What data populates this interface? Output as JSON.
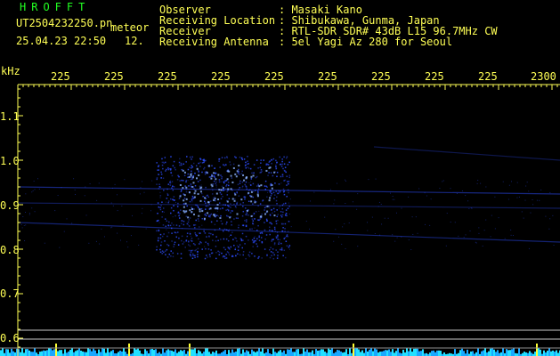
{
  "header": {
    "logo": "HROFFT",
    "filename": "UT2504232250.pn",
    "meteor": "meteor",
    "datetime": "25.04.23 22:50",
    "code": "12.",
    "observer_label": "Observer",
    "observer_value": ": Masaki Kano",
    "location_label": "Receiving Location",
    "location_value": ": Shibukawa, Gunma, Japan",
    "receiver_label": "Receiver",
    "receiver_value": ": RTL-SDR SDR# 43dB L15 96.7MHz CW",
    "antenna_label": "Receiving Antenna",
    "antenna_value": ": 5el Yagi Az 280 for Seoul"
  },
  "y_axis": {
    "unit": "kHz",
    "ticks": [
      "1.1",
      "1.0",
      "0.9",
      "0.8",
      "0.7",
      "0.6"
    ]
  },
  "x_axis": {
    "ticks": [
      "225",
      "225",
      "225",
      "225",
      "225",
      "225",
      "225",
      "225",
      "225",
      "2300"
    ]
  },
  "colors": {
    "label": "#ffff55",
    "logo": "#22ff22",
    "background": "#000000",
    "echo": "#2d4dff",
    "axis": "#ffff55"
  }
}
